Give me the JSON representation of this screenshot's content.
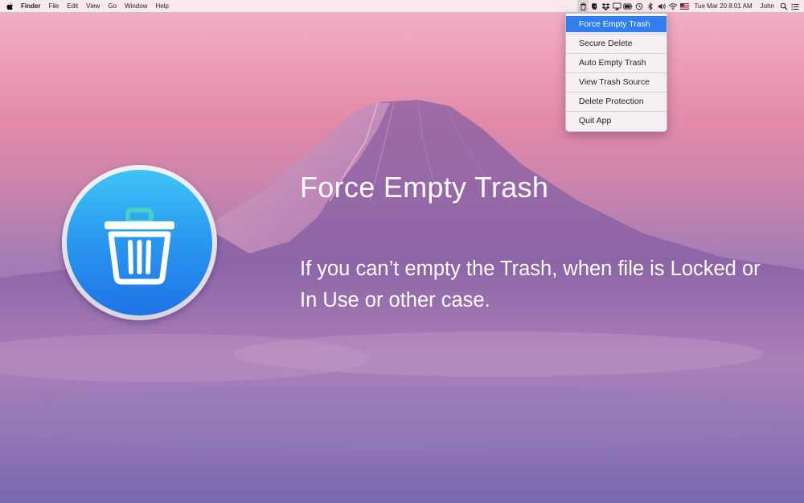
{
  "menubar": {
    "app_name": "Finder",
    "menus": [
      "File",
      "Edit",
      "View",
      "Go",
      "Window",
      "Help"
    ],
    "clock": "Tue Mar 20  8:01 AM",
    "user": "John"
  },
  "dropdown": {
    "items": [
      {
        "label": "Force Empty Trash",
        "selected": true
      },
      {
        "label": "Secure Delete"
      },
      {
        "label": "Auto Empty Trash"
      },
      {
        "label": "View Trash Source"
      },
      {
        "label": "Delete Protection"
      },
      {
        "label": "Quit App"
      }
    ]
  },
  "hero": {
    "title": "Force Empty Trash",
    "description": "If you can’t empty the Trash, when file is Locked or In Use or other case."
  },
  "colors": {
    "selection": "#2f7ff0",
    "icon_top": "#3fc5f7",
    "icon_bottom": "#1f73e6"
  },
  "icons": {
    "apple": "apple-logo-icon",
    "trash": "trash-can-icon",
    "menubar_status": [
      "trash-status-icon",
      "evernote-icon",
      "dropbox-icon",
      "airplay-icon",
      "battery-icon",
      "time-machine-icon",
      "bluetooth-icon",
      "volume-icon",
      "wifi-icon",
      "flag-icon"
    ]
  }
}
